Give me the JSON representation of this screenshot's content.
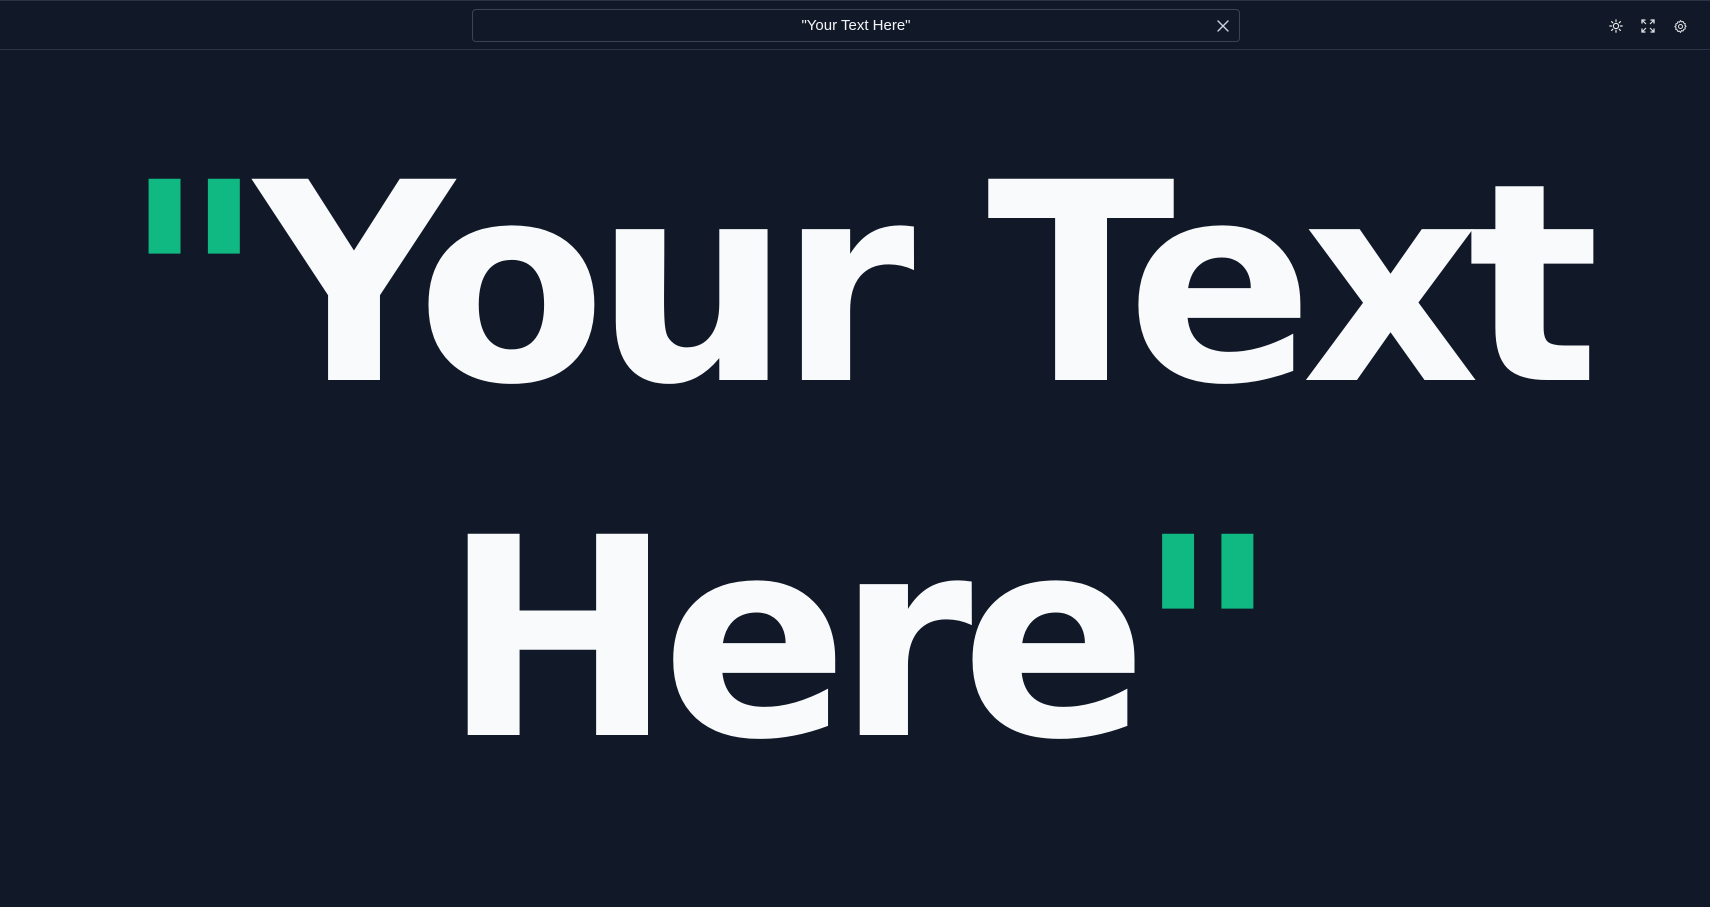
{
  "toolbar": {
    "text_value": "\"Your Text Here\"",
    "clear_icon": "close-icon",
    "theme_icon": "sun-icon",
    "fullscreen_icon": "expand-icon",
    "settings_icon": "gear-icon"
  },
  "display": {
    "open_quote": "\"",
    "text": "Your Text Here",
    "close_quote": "\""
  },
  "colors": {
    "background": "#111827",
    "text": "#f8fafc",
    "accent": "#10b981"
  }
}
